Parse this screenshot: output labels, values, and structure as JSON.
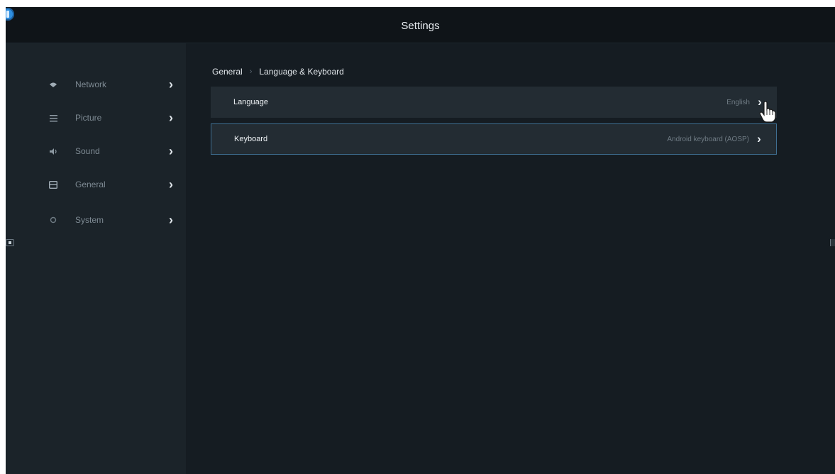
{
  "header": {
    "title": "Settings",
    "app_icon": "app-logo-icon"
  },
  "sidebar": {
    "items": [
      {
        "label": "Network",
        "icon": "wifi-icon"
      },
      {
        "label": "Picture",
        "icon": "picture-icon"
      },
      {
        "label": "Sound",
        "icon": "sound-icon"
      },
      {
        "label": "General",
        "icon": "general-icon"
      },
      {
        "label": "System",
        "icon": "system-icon"
      }
    ],
    "chevron": "›"
  },
  "breadcrumb": {
    "parent": "General",
    "separator": "›",
    "current": "Language & Keyboard"
  },
  "settings": [
    {
      "label": "Language",
      "value": "English"
    },
    {
      "label": "Keyboard",
      "value": "Android keyboard (AOSP)"
    }
  ],
  "colors": {
    "background": "#151c22",
    "sidebar": "#1b2329",
    "row": "#232c33",
    "focus_border": "#3f6f92",
    "accent": "#2f8fe0"
  }
}
